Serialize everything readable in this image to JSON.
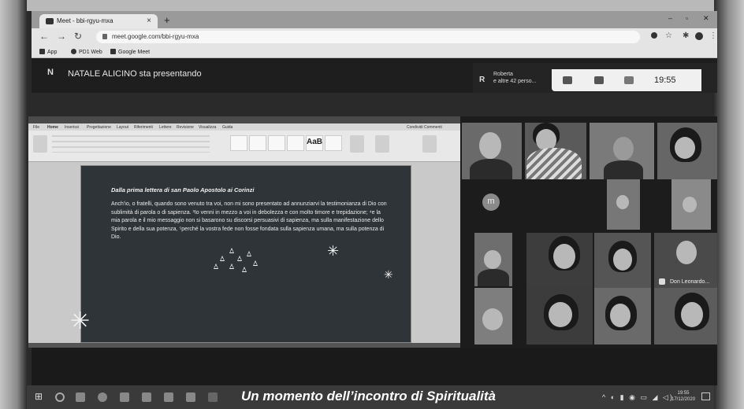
{
  "browser": {
    "tab_title": "Meet - bbi-rgyu-mxa",
    "url": "meet.google.com/bbi-rgyu-mxa",
    "bookmarks": [
      "App",
      "PD1 Web",
      "Google Meet"
    ]
  },
  "meet": {
    "presenter_initial": "N",
    "presenter_text": "NATALE ALICINO sta presentando",
    "participants_initial": "R",
    "participants_line1": "Roberta",
    "participants_line2": "e altre 42 perso...",
    "clock": "19:55",
    "avatar_letter": "m",
    "tile_label": "Don Leonardo..."
  },
  "word": {
    "ribbon_tabs": [
      "File",
      "Home",
      "Inserisci",
      "Progettazione",
      "Layout",
      "Riferimenti",
      "Lettere",
      "Revisione",
      "Visualizza",
      "Guida"
    ],
    "style_big": "AaB",
    "comments_label": "Condividi   Commenti"
  },
  "slide": {
    "heading": "Dalla prima lettera di san Paolo Apostolo ai Corinzi",
    "body": "Anch'io, o fratelli, quando sono venuto tra voi, non mi sono presentato ad annunziarvi la testimonianza di Dio con sublimità di parola o di sapienza. ³Io venni in mezzo a voi in debolezza e con molto timore e trepidazione; ⁴e la mia parola e il mio messaggio non si basarono su discorsi persuasivi di sapienza, ma sulla manifestazione dello Spirito e della sua potenza, ⁵perché la vostra fede non fosse fondata sulla sapienza umana, ma sulla potenza di Dio."
  },
  "taskbar": {
    "time": "19:55",
    "date": "17/12/2020"
  },
  "caption": "Un momento dell’incontro di Spiritualità"
}
